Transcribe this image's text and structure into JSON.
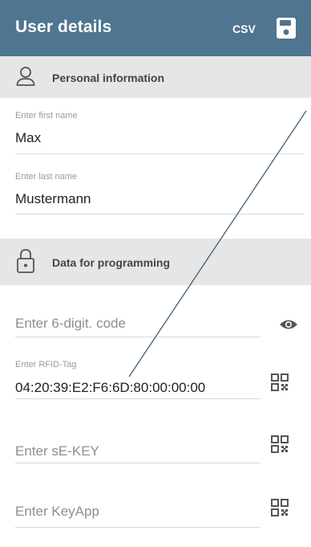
{
  "toolbar": {
    "title": "User details",
    "csv_label": "CSV",
    "save_icon": "save-icon"
  },
  "sections": {
    "personal": {
      "label": "Personal information",
      "icon": "person-icon"
    },
    "programming": {
      "label": "Data for programming",
      "icon": "lock-icon"
    }
  },
  "fields": {
    "first_name": {
      "hint": "Enter first name",
      "value": "Max"
    },
    "last_name": {
      "hint": "Enter last name",
      "value": "Mustermann"
    },
    "code": {
      "placeholder": "Enter 6-digit. code",
      "icon": "eye-icon"
    },
    "rfid": {
      "hint": "Enter RFID-Tag",
      "value": "04:20:39:E2:F6:6D:80:00:00:00",
      "icon": "qr-code-icon"
    },
    "se_key": {
      "placeholder": "Enter sE-KEY",
      "icon": "qr-code-icon"
    },
    "keyapp": {
      "placeholder": "Enter KeyApp",
      "icon": "qr-code-icon"
    }
  },
  "colors": {
    "toolbar": "#4f7590",
    "section_bg": "#e6e6e6",
    "annotation_line": "#3b5f7c"
  }
}
